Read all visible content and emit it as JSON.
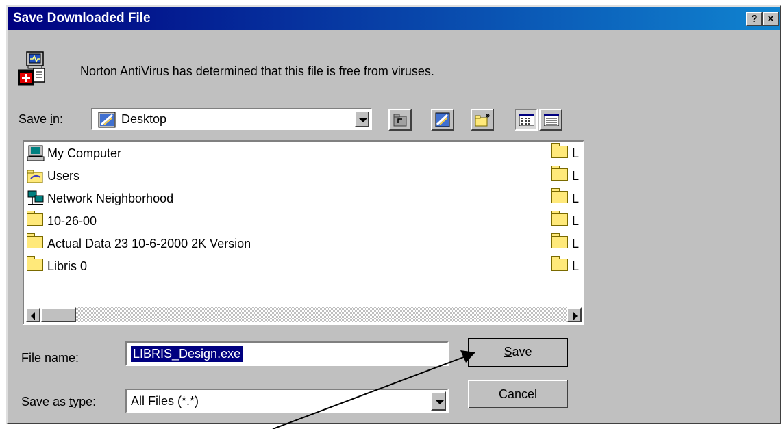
{
  "window": {
    "title": "Save Downloaded File",
    "help_label": "?",
    "close_label": "×"
  },
  "notice": {
    "text": "Norton AntiVirus has determined that this file is free from viruses."
  },
  "save_in": {
    "label_pre": "Save ",
    "label_key": "i",
    "label_post": "n:",
    "value": "Desktop"
  },
  "toolbar": {
    "buttons": [
      "up-one-level",
      "desktop",
      "create-new-folder",
      "list-view",
      "details-view"
    ]
  },
  "files": {
    "left_items": [
      {
        "name": "My Computer",
        "icon": "computer-icon"
      },
      {
        "name": "Users",
        "icon": "folder-icon"
      },
      {
        "name": "Network Neighborhood",
        "icon": "network-icon"
      },
      {
        "name": "10-26-00",
        "icon": "folder-icon"
      },
      {
        "name": "Actual Data 23 10-6-2000 2K Version",
        "icon": "folder-icon"
      },
      {
        "name": "Libris 0",
        "icon": "folder-icon"
      }
    ],
    "right_items": [
      "L",
      "L",
      "L",
      "L",
      "L",
      "L"
    ]
  },
  "file_name": {
    "label_pre": "File ",
    "label_key": "n",
    "label_post": "ame:",
    "value": "LIBRIS_Design.exe"
  },
  "save_type": {
    "label_pre": "Save as ",
    "label_key": "t",
    "label_post": "ype:",
    "value": "All Files (*.*)"
  },
  "buttons": {
    "save_key": "S",
    "save_rest": "ave",
    "cancel": "Cancel"
  },
  "colors": {
    "title_start": "#000080",
    "title_end": "#1084d0",
    "face": "#c0c0c0",
    "selection": "#000080"
  }
}
